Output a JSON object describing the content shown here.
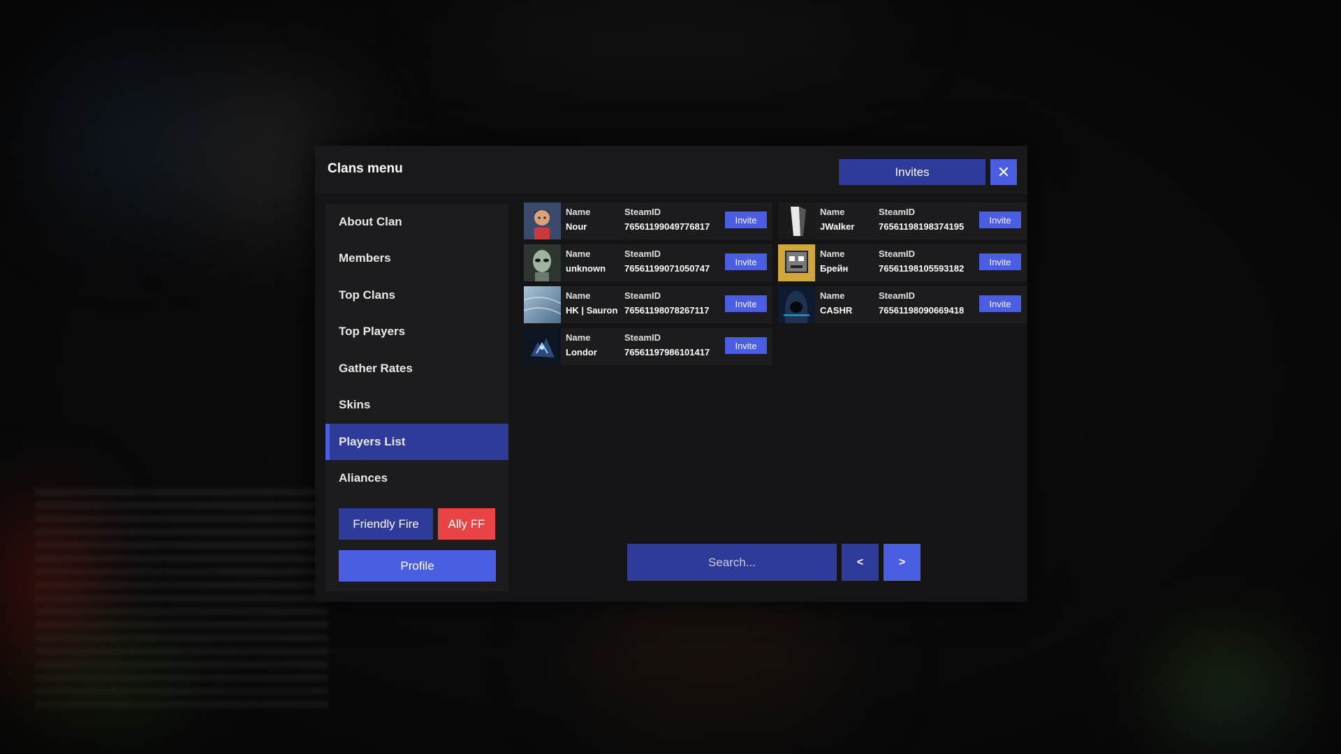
{
  "modal": {
    "title": "Clans menu",
    "invites_label": "Invites",
    "close_glyph": "✕"
  },
  "sidebar": {
    "items": [
      {
        "label": "About Clan",
        "active": false
      },
      {
        "label": "Members",
        "active": false
      },
      {
        "label": "Top Clans",
        "active": false
      },
      {
        "label": "Top Players",
        "active": false
      },
      {
        "label": "Gather Rates",
        "active": false
      },
      {
        "label": "Skins",
        "active": false
      },
      {
        "label": "Players List",
        "active": true
      },
      {
        "label": "Aliances",
        "active": false
      }
    ],
    "friendly_fire_label": "Friendly Fire",
    "ally_ff_label": "Ally FF",
    "profile_label": "Profile"
  },
  "players": {
    "name_header": "Name",
    "steamid_header": "SteamID",
    "invite_label": "Invite",
    "list": [
      {
        "name": "Nour",
        "steamid": "76561199049776817",
        "avatar": "cartoon-man-avatar"
      },
      {
        "name": "JWalker",
        "steamid": "76561198198374195",
        "avatar": "dark-figure-avatar"
      },
      {
        "name": "unknown",
        "steamid": "76561199071050747",
        "avatar": "alien-avatar"
      },
      {
        "name": "Брейн",
        "steamid": "76561198105593182",
        "avatar": "robot-avatar"
      },
      {
        "name": "HK | Sauron",
        "steamid": "76561198078267117",
        "avatar": "blue-texture-avatar"
      },
      {
        "name": "CASHR",
        "steamid": "76561198090669418",
        "avatar": "hooded-figure-avatar"
      },
      {
        "name": "Londor",
        "steamid": "76561197986101417",
        "avatar": "blue-creature-avatar"
      }
    ]
  },
  "search": {
    "placeholder": "Search...",
    "prev_label": "<",
    "next_label": ">"
  },
  "colors": {
    "accent": "#4b5de0",
    "accent_dark": "#2f3b99",
    "danger": "#e94444",
    "panel": "#141416"
  }
}
